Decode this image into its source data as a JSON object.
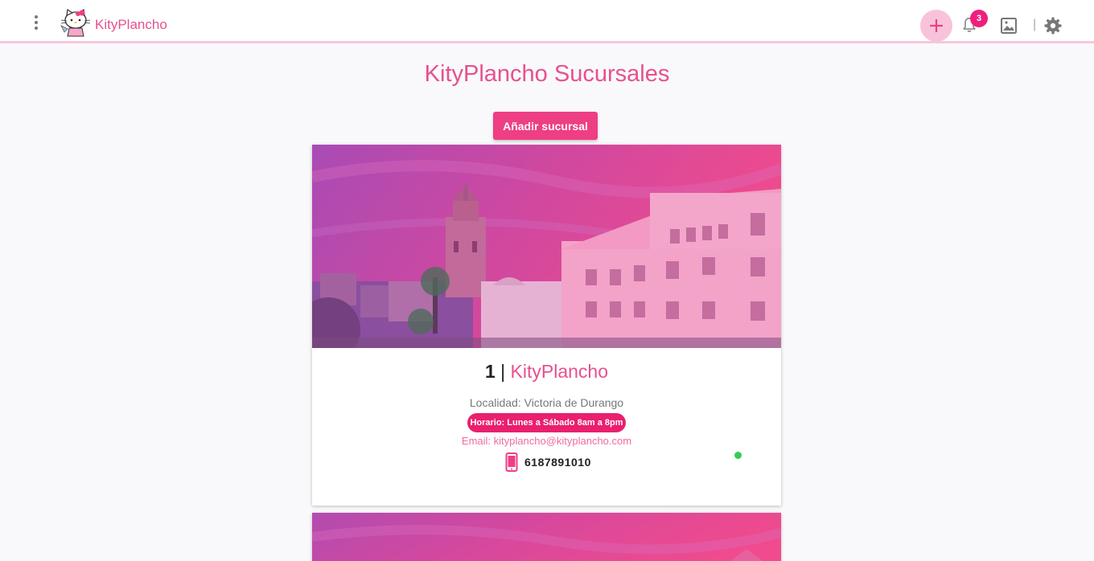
{
  "header": {
    "brand": "KityPlancho",
    "notification_count": "3",
    "separator": "|"
  },
  "page": {
    "title": "KityPlancho Sucursales",
    "add_button_label": "Añadir sucursal"
  },
  "branches": [
    {
      "number": "1",
      "separator": "|",
      "name": "KityPlancho",
      "locality": "Localidad: Victoria de Durango",
      "hours": "Horario: Lunes a Sábado 8am a 8pm",
      "email": "Email: kityplancho@kityplancho.com",
      "phone": "6187891010",
      "status_color": "#33cc55"
    }
  ],
  "colors": {
    "brand_pink": "#e8508f",
    "button_pink": "#ee3e84",
    "badge_pink": "#ee1f7d",
    "topbar_border": "#f8c6dc"
  },
  "icons": {
    "menu": "kebab-menu-icon",
    "add": "plus-icon",
    "notifications": "bell-icon",
    "gallery": "image-icon",
    "settings": "gear-icon",
    "phone": "smartphone-icon"
  }
}
